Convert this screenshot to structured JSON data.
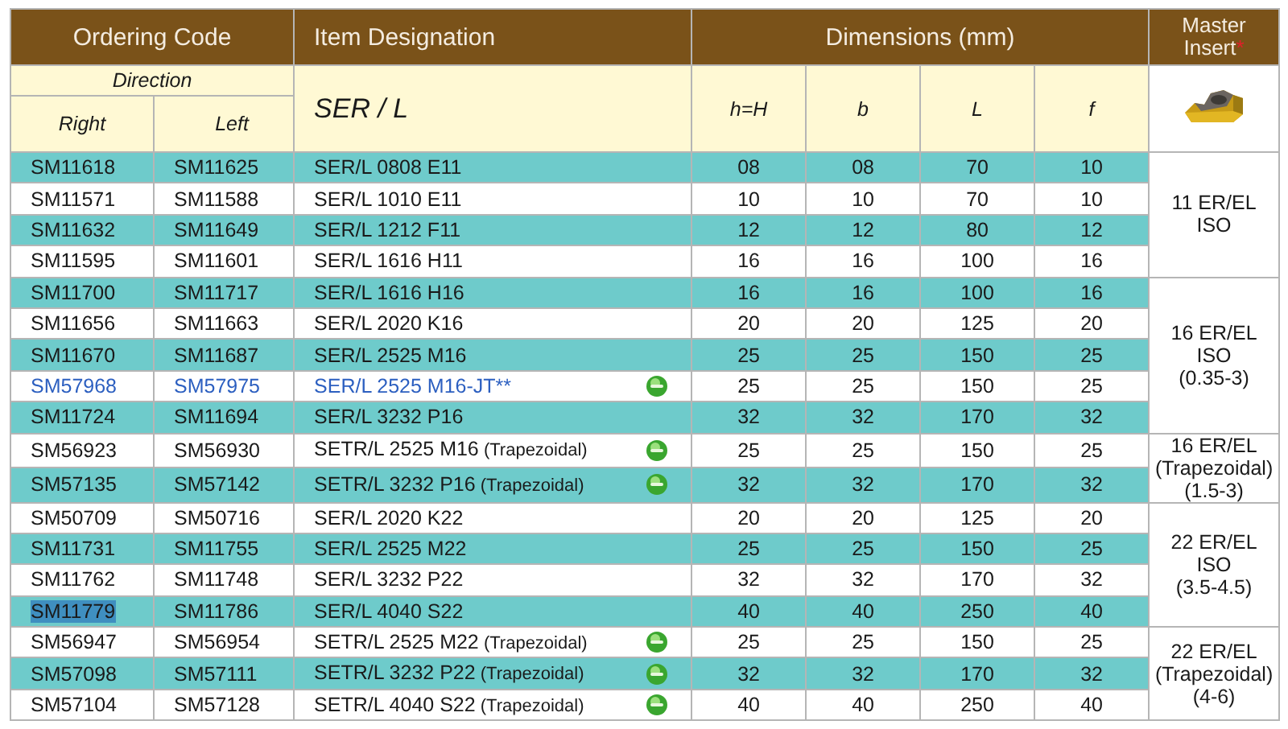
{
  "header": {
    "ordering_code": "Ordering Code",
    "item_designation": "Item Designation",
    "dimensions": "Dimensions (mm)",
    "master_insert": "Master Insert",
    "master_insert_mark": "*"
  },
  "subheader": {
    "direction": "Direction",
    "right": "Right",
    "left": "Left",
    "designation": "SER / L",
    "dimension_columns": [
      "h=H",
      "b",
      "L",
      "f"
    ]
  },
  "groups": [
    {
      "master": [
        "11 ER/EL",
        "ISO"
      ],
      "rows": [
        {
          "right": "SM11618",
          "left": "SM11625",
          "designation": "SER/L 0808 E11",
          "note": "",
          "badge": false,
          "kind": "standard",
          "highlighted": false,
          "dims": [
            "08",
            "08",
            "70",
            "10"
          ]
        },
        {
          "right": "SM11571",
          "left": "SM11588",
          "designation": "SER/L 1010 E11",
          "note": "",
          "badge": false,
          "kind": "standard",
          "highlighted": false,
          "dims": [
            "10",
            "10",
            "70",
            "10"
          ]
        },
        {
          "right": "SM11632",
          "left": "SM11649",
          "designation": "SER/L 1212 F11",
          "note": "",
          "badge": false,
          "kind": "standard",
          "highlighted": false,
          "dims": [
            "12",
            "12",
            "80",
            "12"
          ]
        },
        {
          "right": "SM11595",
          "left": "SM11601",
          "designation": "SER/L 1616 H11",
          "note": "",
          "badge": false,
          "kind": "standard",
          "highlighted": false,
          "dims": [
            "16",
            "16",
            "100",
            "16"
          ]
        }
      ]
    },
    {
      "master": [
        "16 ER/EL",
        "ISO",
        "(0.35-3)"
      ],
      "rows": [
        {
          "right": "SM11700",
          "left": "SM11717",
          "designation": "SER/L 1616 H16",
          "badge": false,
          "kind": "standard",
          "highlighted": false,
          "dims": [
            "16",
            "16",
            "100",
            "16"
          ]
        },
        {
          "right": "SM11656",
          "left": "SM11663",
          "designation": "SER/L 2020 K16",
          "badge": false,
          "kind": "standard",
          "highlighted": false,
          "dims": [
            "20",
            "20",
            "125",
            "20"
          ]
        },
        {
          "right": "SM11670",
          "left": "SM11687",
          "designation": "SER/L 2525 M16",
          "badge": false,
          "kind": "standard",
          "highlighted": false,
          "dims": [
            "25",
            "25",
            "150",
            "25"
          ]
        },
        {
          "right": "SM57968",
          "left": "SM57975",
          "designation": "SER/L 2525 M16-JT**",
          "badge": true,
          "kind": "new",
          "highlighted": false,
          "dims": [
            "25",
            "25",
            "150",
            "25"
          ]
        },
        {
          "right": "SM11724",
          "left": "SM11694",
          "designation": "SER/L 3232 P16",
          "badge": false,
          "kind": "standard",
          "highlighted": false,
          "dims": [
            "32",
            "32",
            "170",
            "32"
          ]
        }
      ]
    },
    {
      "master": [
        "16 ER/EL",
        "(Trapezoidal)",
        "(1.5-3)"
      ],
      "rows": [
        {
          "right": "SM56923",
          "left": "SM56930",
          "designation": "SETR/L 2525 M16",
          "note": "(Trapezoidal)",
          "badge": true,
          "kind": "standard",
          "highlighted": false,
          "dims": [
            "25",
            "25",
            "150",
            "25"
          ]
        },
        {
          "right": "SM57135",
          "left": "SM57142",
          "designation": "SETR/L 3232 P16",
          "note": "(Trapezoidal)",
          "badge": true,
          "kind": "standard",
          "highlighted": false,
          "dims": [
            "32",
            "32",
            "170",
            "32"
          ]
        }
      ]
    },
    {
      "master": [
        "22 ER/EL",
        "ISO",
        "(3.5-4.5)"
      ],
      "rows": [
        {
          "right": "SM50709",
          "left": "SM50716",
          "designation": "SER/L 2020 K22",
          "badge": false,
          "kind": "standard",
          "highlighted": false,
          "dims": [
            "20",
            "20",
            "125",
            "20"
          ]
        },
        {
          "right": "SM11731",
          "left": "SM11755",
          "designation": "SER/L 2525 M22",
          "badge": false,
          "kind": "standard",
          "highlighted": false,
          "dims": [
            "25",
            "25",
            "150",
            "25"
          ]
        },
        {
          "right": "SM11762",
          "left": "SM11748",
          "designation": "SER/L 3232 P22",
          "badge": false,
          "kind": "standard",
          "highlighted": false,
          "dims": [
            "32",
            "32",
            "170",
            "32"
          ]
        },
        {
          "right": "SM11779",
          "left": "SM11786",
          "designation": "SER/L 4040 S22",
          "badge": false,
          "kind": "standard",
          "highlighted": true,
          "dims": [
            "40",
            "40",
            "250",
            "40"
          ]
        }
      ]
    },
    {
      "master": [
        "22 ER/EL",
        "(Trapezoidal)",
        "(4-6)"
      ],
      "rows": [
        {
          "right": "SM56947",
          "left": "SM56954",
          "designation": "SETR/L 2525 M22",
          "note": "(Trapezoidal)",
          "badge": true,
          "kind": "standard",
          "highlighted": false,
          "dims": [
            "25",
            "25",
            "150",
            "25"
          ]
        },
        {
          "right": "SM57098",
          "left": "SM57111",
          "designation": "SETR/L 3232 P22",
          "note": "(Trapezoidal)",
          "badge": true,
          "kind": "standard",
          "highlighted": false,
          "dims": [
            "32",
            "32",
            "170",
            "32"
          ]
        },
        {
          "right": "SM57104",
          "left": "SM57128",
          "designation": "SETR/L 4040 S22",
          "note": "(Trapezoidal)",
          "badge": true,
          "kind": "standard",
          "highlighted": false,
          "dims": [
            "40",
            "40",
            "250",
            "40"
          ]
        }
      ]
    }
  ]
}
